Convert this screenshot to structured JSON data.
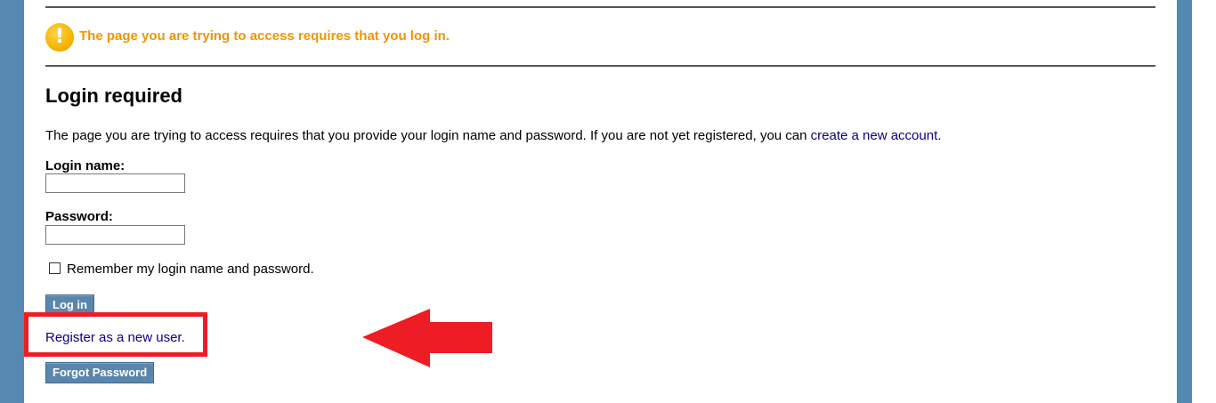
{
  "alert": {
    "message": "The page you are trying to access requires that you log in.",
    "icon": "warning-icon",
    "icon_glyph": "!"
  },
  "login": {
    "title": "Login required",
    "intro_text": "The page you are trying to access requires that you provide your login name and password. If you are not yet registered, you can ",
    "create_account_link": "create a new account",
    "intro_end": ".",
    "login_name_label": "Login name:",
    "login_name_value": "",
    "password_label": "Password:",
    "password_value": "",
    "remember_label": "Remember my login name and password.",
    "login_button": "Log in",
    "register_link": "Register as a new user.",
    "forgot_button": "Forgot Password"
  },
  "annotation": {
    "box_color": "#ee1c25",
    "arrow_color": "#ee1c25",
    "arrow_icon": "left-arrow-icon"
  }
}
